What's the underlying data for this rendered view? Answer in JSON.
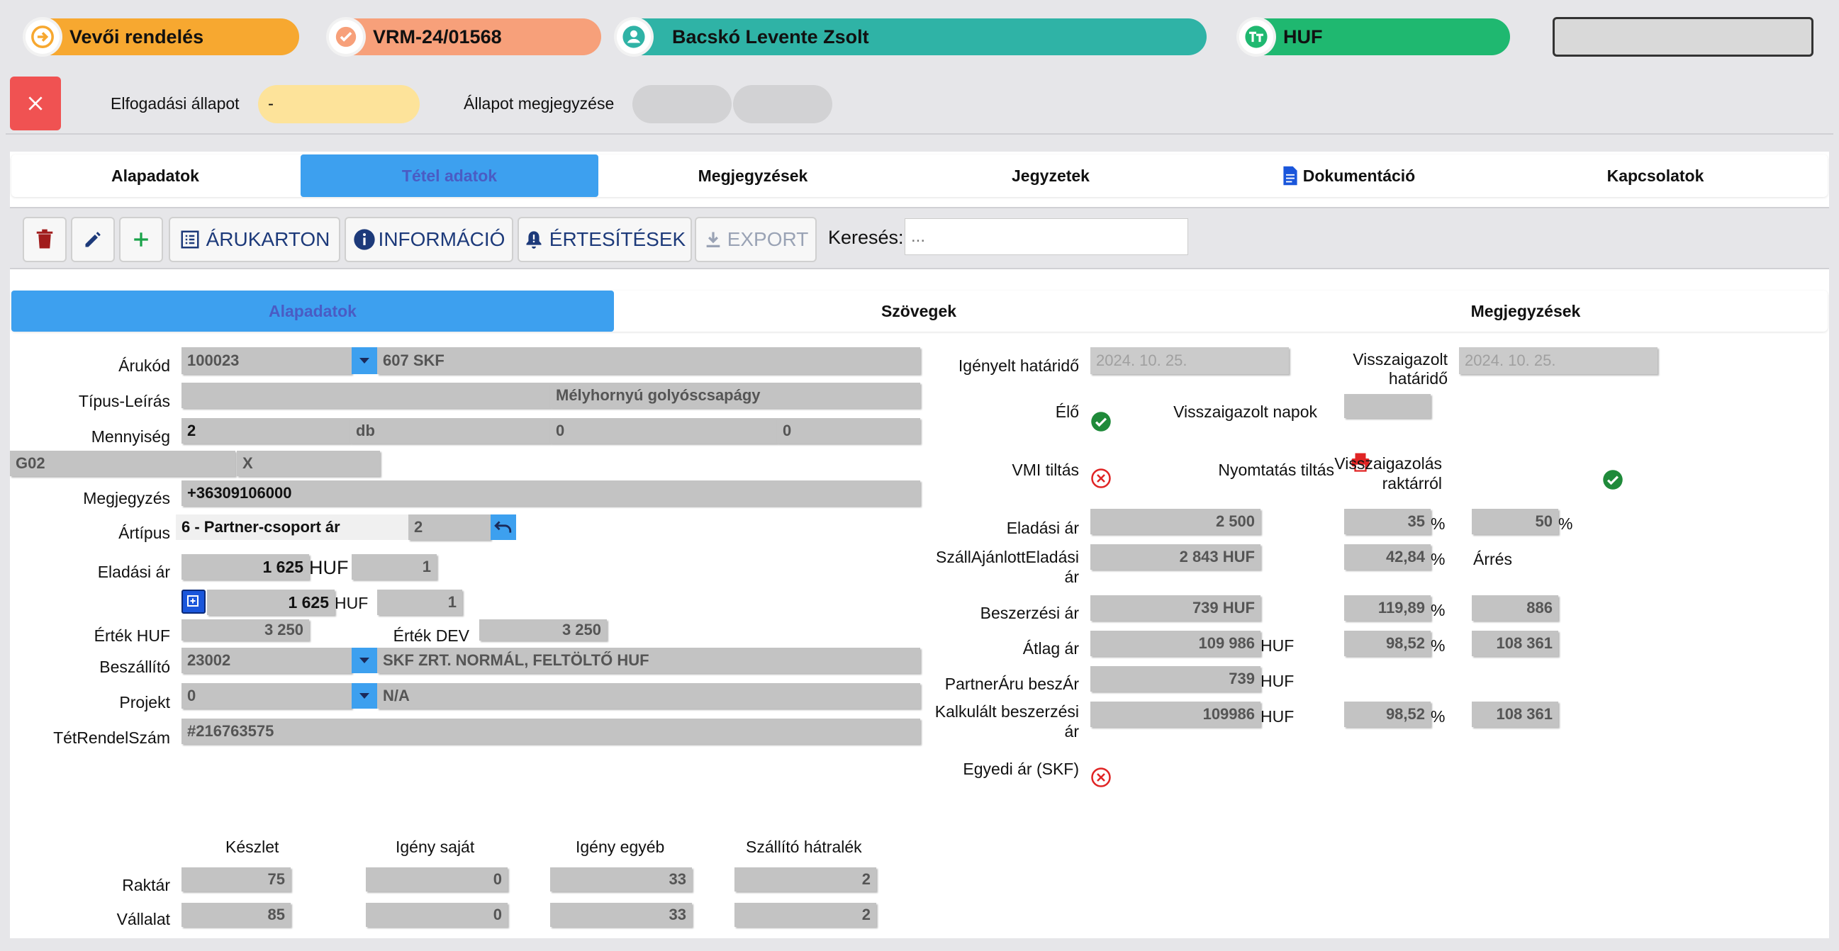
{
  "header": {
    "doc_type": "Vevői rendelés",
    "doc_number": "VRM-24/01568",
    "customer": "Bacskó Levente Zsolt",
    "currency": "HUF",
    "colors": {
      "doc_type": "#f7a830",
      "doc_number": "#f7a07a",
      "customer": "#2fb3a6",
      "currency": "#1fb870"
    }
  },
  "status_bar": {
    "acceptance_label": "Elfogadási állapot",
    "acceptance_value": "-",
    "status_note_label": "Állapot megjegyzése"
  },
  "main_tabs": [
    "Alapadatok",
    "Tétel adatok",
    "Megjegyzések",
    "Jegyzetek",
    "Dokumentáció",
    "Kapcsolatok"
  ],
  "toolbar": {
    "arukarton": "ÁRUKARTON",
    "informacio": "INFORMÁCIÓ",
    "ertesitesek": "ÉRTESÍTÉSEK",
    "export": "EXPORT",
    "search_label": "Keresés:",
    "search_placeholder": "..."
  },
  "sub_tabs": [
    "Alapadatok",
    "Szövegek",
    "Megjegyzések"
  ],
  "left": {
    "arukod_label": "Árukód",
    "arukod": "100023",
    "arukod_desc": "607 SKF",
    "tipus_label": "Típus-Leírás",
    "tipus_desc": "Mélyhornyú golyóscsapágy",
    "mennyiseg_label": "Mennyiség",
    "mennyiseg": "2",
    "mennyiseg_unit": "db",
    "mennyiseg_c": "0",
    "mennyiseg_d": "0",
    "g02": "G02",
    "x": "X",
    "megjegyzes_label": "Megjegyzés",
    "megjegyzes": "+36309106000",
    "artipus_label": "Ártípus",
    "artipus": "6 - Partner-csoport ár",
    "artipus_num": "2",
    "eladasi_ar_label": "Eladási ár",
    "eladasi_ar": "1 625",
    "eladasi_ar_cur": "HUF",
    "eladasi_ar_q": "1",
    "eladasi_ar2": "1 625",
    "eladasi_ar2_cur": "HUF",
    "eladasi_ar2_q": "1",
    "ertek_huf_label": "Érték HUF",
    "ertek_huf": "3 250",
    "ertek_dev_label": "Érték DEV",
    "ertek_dev": "3 250",
    "beszallito_label": "Beszállító",
    "beszallito": "23002",
    "beszallito_name": "SKF ZRT. NORMÁL, FELTÖLTŐ HUF",
    "projekt_label": "Projekt",
    "projekt": "0",
    "projekt_name": "N/A",
    "tetrendelszam_label": "TétRendelSzám",
    "tetrendelszam": "#216763575"
  },
  "stock": {
    "headers": [
      "Készlet",
      "Igény saját",
      "Igény egyéb",
      "Szállító hátralék"
    ],
    "rows": [
      {
        "label": "Raktár",
        "values": [
          "75",
          "0",
          "33",
          "2"
        ]
      },
      {
        "label": "Vállalat",
        "values": [
          "85",
          "0",
          "33",
          "2"
        ]
      }
    ]
  },
  "right": {
    "igenyelt_label": "Igényelt határidő",
    "igenyelt": "2024. 10. 25.",
    "visszaig_hat_label_1": "Visszaigazolt",
    "visszaig_hat_label_2": "határidő",
    "visszaig_hat": "2024. 10. 25.",
    "elo_label": "Élő",
    "visszaig_napok_label": "Visszaigazolt napok",
    "vmi_label": "VMI tiltás",
    "nyomtatas_label": "Nyomtatás tiltás",
    "visszaig_rakt_label_1": "Visszaigazolás",
    "visszaig_rakt_label_2": "raktárról",
    "eladasi_label": "Eladási ár",
    "eladasi": "2 500",
    "eladasi_p1": "35",
    "eladasi_p2": "50",
    "szall_label_1": "SzállAjánlottEladási",
    "szall_label_2": "ár",
    "szall": "2 843",
    "szall_cur": "HUF",
    "szall_p": "42,84",
    "arres_label": "Árrés",
    "beszerzesi_label": "Beszerzési ár",
    "beszerzesi": "739",
    "beszerzesi_cur": "HUF",
    "beszerzesi_p": "119,89",
    "beszerzesi_v": "886",
    "atlag_label": "Átlag ár",
    "atlag": "109 986",
    "atlag_cur": "HUF",
    "atlag_p": "98,52",
    "atlag_v": "108 361",
    "partner_label": "PartnerÁru beszÁr",
    "partner": "739",
    "partner_cur": "HUF",
    "kalk_label_1": "Kalkulált beszerzési",
    "kalk_label_2": "ár",
    "kalk": "109986",
    "kalk_cur": "HUF",
    "kalk_p": "98,52",
    "kalk_v": "108 361",
    "egyedi_label": "Egyedi ár (SKF)",
    "percent": "%"
  }
}
